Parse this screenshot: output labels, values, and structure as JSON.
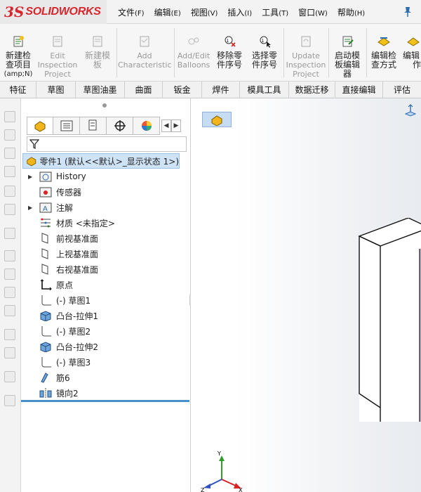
{
  "app": {
    "logo_mark": "3S",
    "logo_text": "SOLIDWORKS",
    "pin_icon": "pin-icon"
  },
  "menu": [
    {
      "label": "文件",
      "key": "(F)"
    },
    {
      "label": "编辑",
      "key": "(E)"
    },
    {
      "label": "视图",
      "key": "(V)"
    },
    {
      "label": "插入",
      "key": "(I)"
    },
    {
      "label": "工具",
      "key": "(T)"
    },
    {
      "label": "窗口",
      "key": "(W)"
    },
    {
      "label": "帮助",
      "key": "(H)"
    }
  ],
  "commands": {
    "new_inspection": {
      "line1": "新建检",
      "line2": "查项目",
      "line3": "(amp;N)"
    },
    "edit_inspection": {
      "line1": "Edit",
      "line2": "Inspection",
      "line3": "Project"
    },
    "new_template": {
      "line1": "新建模",
      "line2": "板"
    },
    "add_characteristic": {
      "line1": "Add",
      "line2": "Characteristic"
    },
    "add_edit_balloons": {
      "line1": "Add/Edit",
      "line2": "Balloons"
    },
    "remove_serial": {
      "line1": "移除零",
      "line2": "件序号"
    },
    "select_serial": {
      "line1": "选择零",
      "line2": "件序号"
    },
    "update_inspection": {
      "line1": "Update",
      "line2": "Inspection",
      "line3": "Project"
    },
    "launch_template_editor": {
      "line1": "启动模",
      "line2": "板编辑",
      "line3": "器"
    },
    "edit_inspection_method": {
      "line1": "编辑检",
      "line2": "查方式"
    },
    "edit_cut": {
      "line1": "编辑",
      "line2": "作"
    }
  },
  "tabs": [
    "特征",
    "草图",
    "草图油墨",
    "曲面",
    "钣金",
    "焊件",
    "模具工具",
    "数据迁移",
    "直接编辑",
    "评估"
  ],
  "tree": {
    "root": "零件1  (默认<<默认>_显示状态 1>)",
    "items": [
      {
        "label": "History",
        "icon": "history-folder-icon",
        "arrow": "▶"
      },
      {
        "label": "传感器",
        "icon": "sensor-icon",
        "arrow": ""
      },
      {
        "label": "注解",
        "icon": "annotation-icon",
        "arrow": "▶"
      },
      {
        "label": "材质 <未指定>",
        "icon": "material-icon",
        "arrow": ""
      },
      {
        "label": "前视基准面",
        "icon": "plane-icon",
        "arrow": ""
      },
      {
        "label": "上视基准面",
        "icon": "plane-icon",
        "arrow": ""
      },
      {
        "label": "右视基准面",
        "icon": "plane-icon",
        "arrow": ""
      },
      {
        "label": "原点",
        "icon": "origin-icon",
        "arrow": ""
      },
      {
        "label": "(-) 草图1",
        "icon": "sketch-icon",
        "arrow": ""
      },
      {
        "label": "凸台-拉伸1",
        "icon": "boss-extrude-icon",
        "arrow": ""
      },
      {
        "label": "(-) 草图2",
        "icon": "sketch-icon",
        "arrow": ""
      },
      {
        "label": "凸台-拉伸2",
        "icon": "boss-extrude-icon",
        "arrow": ""
      },
      {
        "label": "(-) 草图3",
        "icon": "sketch-icon",
        "arrow": ""
      },
      {
        "label": "筋6",
        "icon": "rib-icon",
        "arrow": ""
      },
      {
        "label": "镜向2",
        "icon": "mirror-icon",
        "arrow": ""
      }
    ]
  },
  "triad": {
    "y": "Y",
    "x": "X",
    "z": "Z"
  },
  "colors": {
    "accent_blue": "#4a90c8",
    "logo_red": "#d8262c",
    "part_face": "#c9b6cf"
  }
}
